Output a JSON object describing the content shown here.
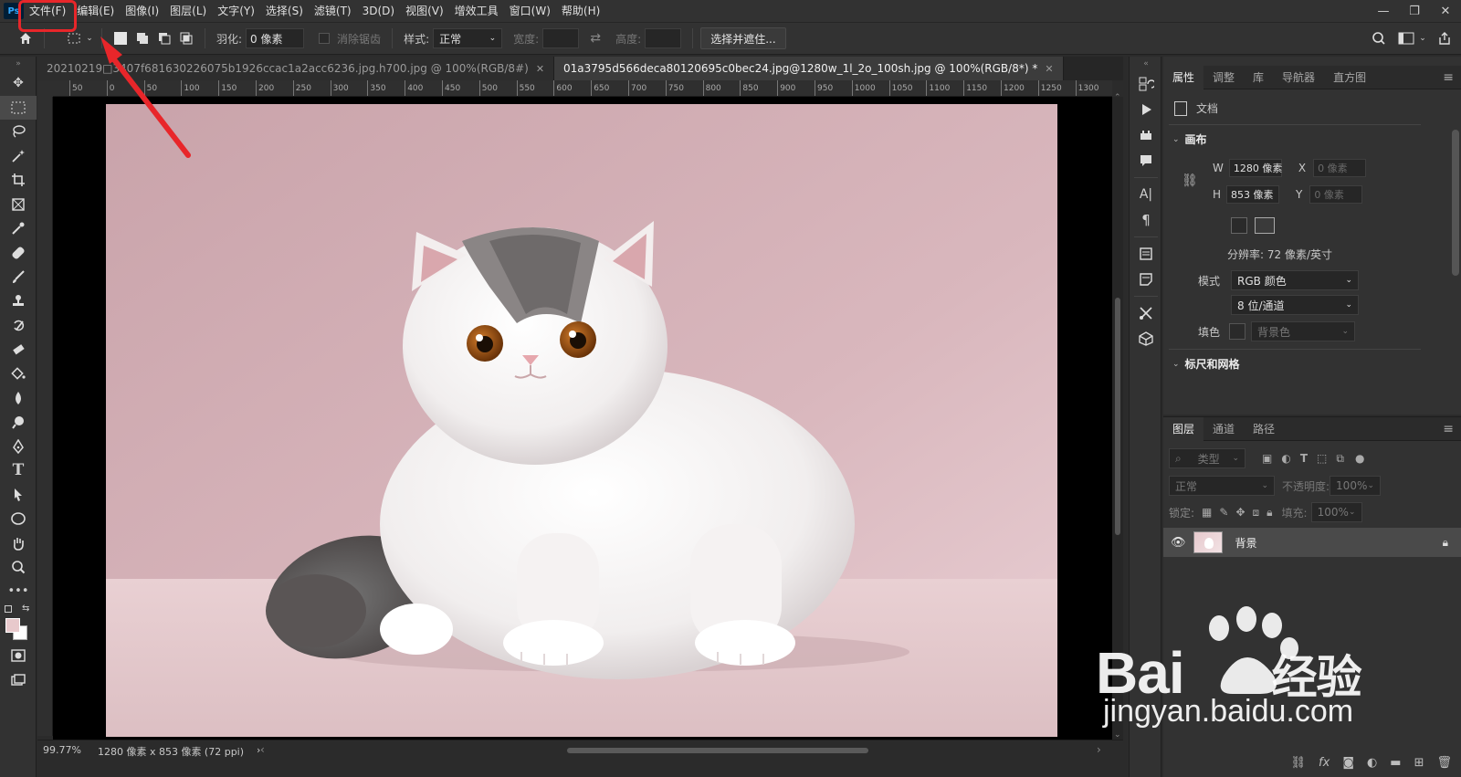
{
  "menubar": {
    "logo": "Ps",
    "items": [
      "文件(F)",
      "编辑(E)",
      "图像(I)",
      "图层(L)",
      "文字(Y)",
      "选择(S)",
      "滤镜(T)",
      "3D(D)",
      "视图(V)",
      "增效工具",
      "窗口(W)",
      "帮助(H)"
    ],
    "window_controls": [
      "—",
      "❐",
      "✕"
    ]
  },
  "options": {
    "feather_label": "羽化:",
    "feather_value": "0 像素",
    "antialias_label": "消除锯齿",
    "style_label": "样式:",
    "style_value": "正常",
    "width_label": "宽度:",
    "height_label": "高度:",
    "select_mask_button": "选择并遮住..."
  },
  "tabs": [
    {
      "label": "20210219□3407f681630226075b1926ccac1a2acc6236.jpg.h700.jpg @ 100%(RGB/8#)",
      "active": false
    },
    {
      "label": "01a3795d566deca80120695c0bec24.jpg@1280w_1l_2o_100sh.jpg @ 100%(RGB/8*) *",
      "active": true
    }
  ],
  "ruler": {
    "ticks": [
      "50",
      "0",
      "50",
      "100",
      "150",
      "200",
      "250",
      "300",
      "350",
      "400",
      "450",
      "500",
      "550",
      "600",
      "650",
      "700",
      "750",
      "800",
      "850",
      "900",
      "950",
      "1000",
      "1050",
      "1100",
      "1150",
      "1200",
      "1250",
      "1300"
    ]
  },
  "status": {
    "zoom": "99.77%",
    "doc_info": "1280 像素 x 853 像素 (72 ppi)",
    "arrow": "›"
  },
  "properties": {
    "tabs": [
      "属性",
      "调整",
      "库",
      "导航器",
      "直方图"
    ],
    "doc_label": "文档",
    "canvas_section": "画布",
    "w_label": "W",
    "w_value": "1280 像素",
    "h_label": "H",
    "h_value": "853 像素",
    "x_label": "X",
    "x_value": "0 像素",
    "y_label": "Y",
    "y_value": "0 像素",
    "resolution": "分辨率: 72 像素/英寸",
    "mode_label": "模式",
    "mode_value": "RGB 颜色",
    "depth_value": "8 位/通道",
    "fill_label": "填色",
    "fill_value": "背景色",
    "rulers_section": "标尺和网格"
  },
  "layers": {
    "tabs": [
      "图层",
      "通道",
      "路径"
    ],
    "filter_placeholder": "类型",
    "blend_mode": "正常",
    "opacity_label": "不透明度:",
    "opacity_value": "100%",
    "lock_label": "锁定:",
    "fill_label": "填充:",
    "fill_value": "100%",
    "layer_name": "背景"
  },
  "watermark": {
    "brand": "Bai",
    "brand2": "经验",
    "url": "jingyan.baidu.com"
  },
  "colors": {
    "annotation": "#e8262a",
    "foreground": "#e8c9cc",
    "background_swatch": "#ffffff",
    "canvas_bg": "#d9b5bb"
  }
}
